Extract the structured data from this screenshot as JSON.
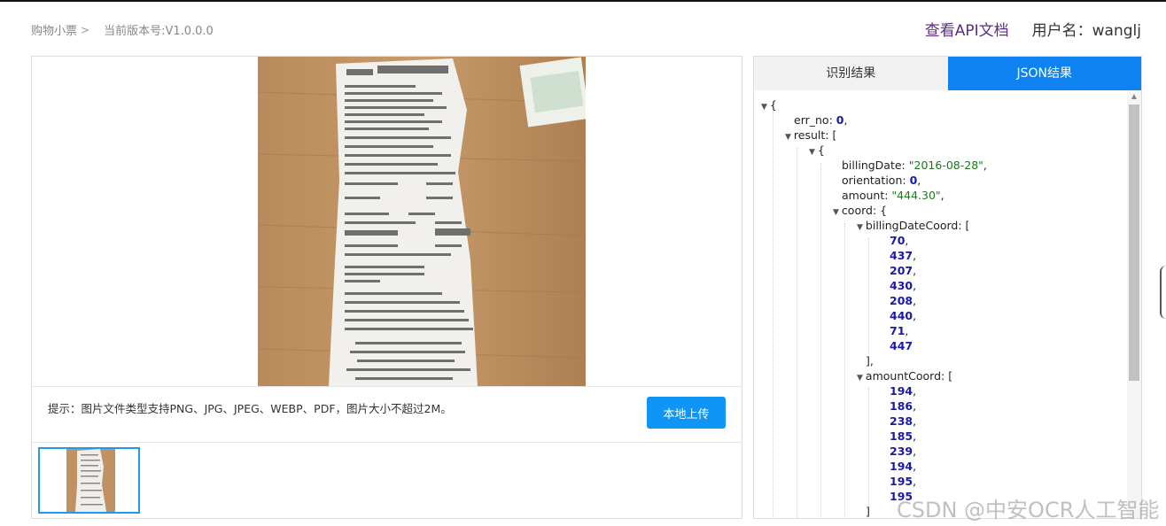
{
  "header": {
    "breadcrumb_item": "购物小票",
    "breadcrumb_sep": ">",
    "version": "当前版本号:V1.0.0.0",
    "api_link": "查看API文档",
    "user_label": "用户名：wanglj"
  },
  "upload": {
    "hint": "提示：图片文件类型支持PNG、JPG、JPEG、WEBP、PDF，图片大小不超过2M。",
    "button": "本地上传"
  },
  "tabs": [
    {
      "label": "识别结果",
      "active": false
    },
    {
      "label": "JSON结果",
      "active": true
    }
  ],
  "json_view": {
    "open_brace": "{",
    "err_no_key": "err_no: ",
    "err_no_val": "0",
    "result_key": "result: [",
    "item_open": "{",
    "billingDate_key": "billingDate: ",
    "billingDate_val": "\"2016-08-28\"",
    "orientation_key": "orientation: ",
    "orientation_val": "0",
    "amount_key": "amount: ",
    "amount_val": "\"444.30\"",
    "coord_key": "coord: {",
    "billingDateCoord_key": "billingDateCoord: [",
    "billingDateCoord": [
      "70",
      "437",
      "207",
      "430",
      "208",
      "440",
      "71",
      "447"
    ],
    "close_arr": "],",
    "amountCoord_key": "amountCoord: [",
    "amountCoord": [
      "194",
      "186",
      "238",
      "185",
      "239",
      "194",
      "195",
      "195"
    ],
    "close_arr2": "]"
  },
  "watermark": "CSDN @中安OCR人工智能",
  "colors": {
    "accent_blue": "#0d82f0",
    "link_purple": "#5b2c83",
    "number_blue": "#1a1aa6",
    "string_green": "#1a7a1a"
  }
}
